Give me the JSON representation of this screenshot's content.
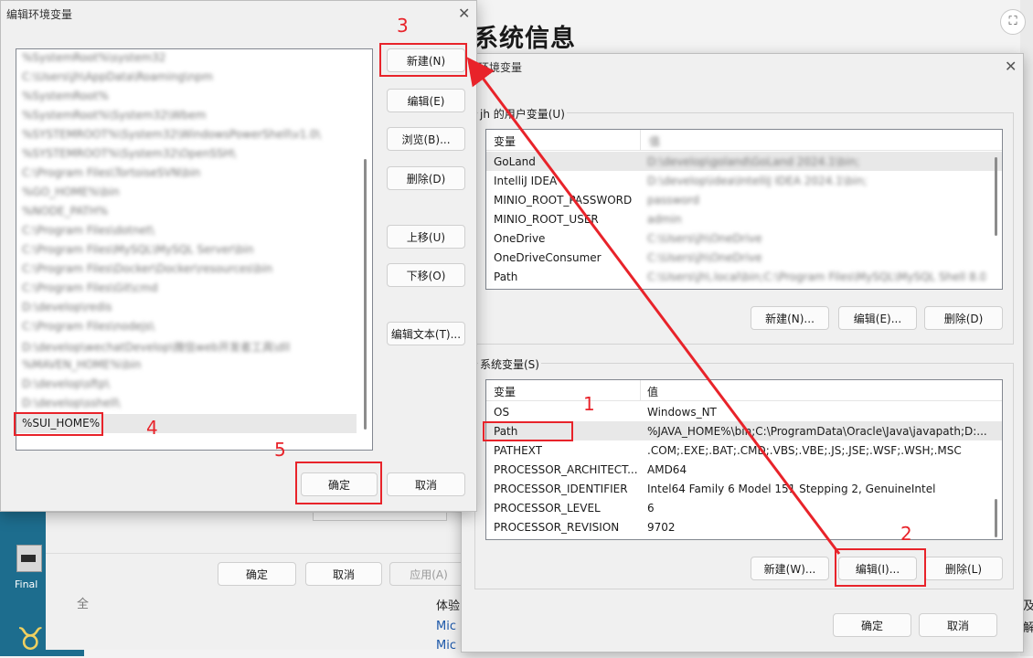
{
  "background": {
    "title": "系统信息",
    "corner_icon": "⛶",
    "desktop_icon_label": "Final",
    "text_ti": "体验",
    "link1": "Mic",
    "link2": "Mic",
    "char1": "及",
    "char2": "解",
    "char3": "全",
    "old_dialog": {
      "ok": "确定",
      "cancel": "取消",
      "apply": "应用(A)"
    }
  },
  "env_dialog": {
    "title": "环境变量",
    "close": "✕",
    "user_group_label": "jh 的用户变量(U)",
    "columns": [
      "变量",
      "值"
    ],
    "user_vars": [
      {
        "name": "GoLand",
        "value": "D:\\develop\\goland\\GoLand 2024.1\\bin;"
      },
      {
        "name": "IntelliJ IDEA",
        "value": "D:\\develop\\idea\\IntelliJ IDEA 2024.1\\bin;"
      },
      {
        "name": "MINIO_ROOT_PASSWORD",
        "value": "password"
      },
      {
        "name": "MINIO_ROOT_USER",
        "value": "admin"
      },
      {
        "name": "OneDrive",
        "value": "C:\\Users\\jh\\OneDrive"
      },
      {
        "name": "OneDriveConsumer",
        "value": "C:\\Users\\jh\\OneDrive"
      },
      {
        "name": "Path",
        "value": "C:\\Users\\jh\\.local\\bin;C:\\Program Files\\MySQL\\MySQL Shell 8.0"
      }
    ],
    "user_buttons": [
      "新建(N)...",
      "编辑(E)...",
      "删除(D)"
    ],
    "system_group_label": "系统变量(S)",
    "system_vars": [
      {
        "name": "OS",
        "value": "Windows_NT"
      },
      {
        "name": "Path",
        "value": "%JAVA_HOME%\\bin;C:\\ProgramData\\Oracle\\Java\\javapath;D:..."
      },
      {
        "name": "PATHEXT",
        "value": ".COM;.EXE;.BAT;.CMD;.VBS;.VBE;.JS;.JSE;.WSF;.WSH;.MSC"
      },
      {
        "name": "PROCESSOR_ARCHITECT...",
        "value": "AMD64"
      },
      {
        "name": "PROCESSOR_IDENTIFIER",
        "value": "Intel64 Family 6 Model 151 Stepping 2, GenuineIntel"
      },
      {
        "name": "PROCESSOR_LEVEL",
        "value": "6"
      },
      {
        "name": "PROCESSOR_REVISION",
        "value": "9702"
      }
    ],
    "system_buttons": [
      "新建(W)...",
      "编辑(I)...",
      "删除(L)"
    ],
    "ok": "确定",
    "cancel": "取消"
  },
  "edit_dialog": {
    "title": "编辑环境变量",
    "close": "✕",
    "items": [
      "%SystemRoot%\\system32",
      "C:\\Users\\jh\\AppData\\Roaming\\npm",
      "%SystemRoot%",
      "%SystemRoot%\\System32\\Wbem",
      "%SYSTEMROOT%\\System32\\WindowsPowerShell\\v1.0\\",
      "%SYSTEMROOT%\\System32\\OpenSSH\\",
      "C:\\Program Files\\TortoiseSVN\\bin",
      "%GO_HOME%\\bin",
      "%NODE_PATH%",
      "C:\\Program Files\\dotnet\\",
      "C:\\Program Files\\MySQL\\MySQL Server\\bin",
      "C:\\Program Files\\Docker\\Docker\\resources\\bin",
      "C:\\Program Files\\Git\\cmd",
      "D:\\develop\\redis",
      "C:\\Program Files\\nodejs\\",
      "D:\\develop\\wechatDevelop\\微信web开发者工具\\dll",
      "%MAVEN_HOME%\\bin",
      "D:\\develop\\sftp\\",
      "D:\\develop\\sshell\\"
    ],
    "new_item": "%SUI_HOME%",
    "buttons": [
      "新建(N)",
      "编辑(E)",
      "浏览(B)...",
      "删除(D)",
      "上移(U)",
      "下移(O)",
      "编辑文本(T)..."
    ],
    "ok": "确定",
    "cancel": "取消"
  },
  "annotations": {
    "step1": "1",
    "step2": "2",
    "step3": "3",
    "step4": "4",
    "step5": "5",
    "color": "#e8232a"
  }
}
